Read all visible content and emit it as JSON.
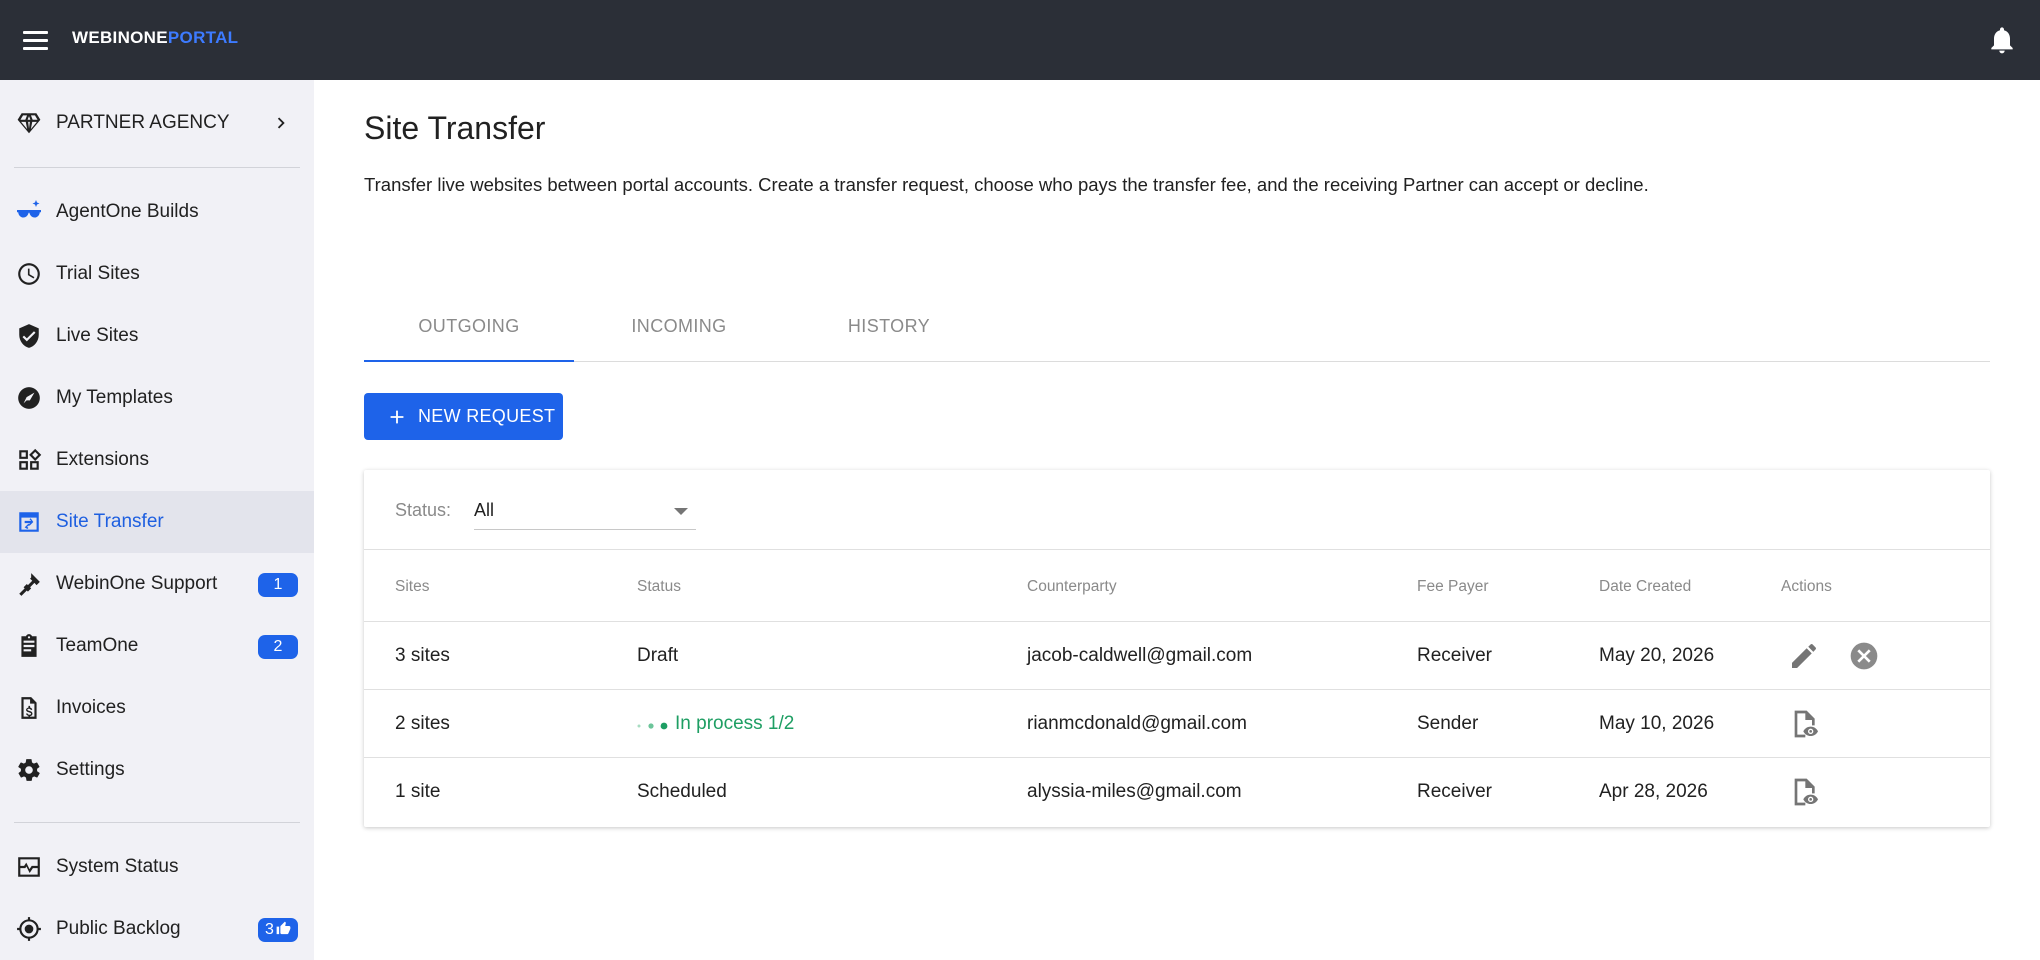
{
  "topbar": {
    "brand_part1": "WEBINONE",
    "brand_part2": "PORTAL",
    "brand_accent_color": "#3d7bff"
  },
  "sidebar": {
    "agency": {
      "label": "PARTNER AGENCY",
      "icon": "diamond-icon"
    },
    "items": [
      {
        "label": "AgentOne Builds",
        "icon": "glasses-sparkle-icon"
      },
      {
        "label": "Trial Sites",
        "icon": "clock-icon"
      },
      {
        "label": "Live Sites",
        "icon": "shield-check-icon"
      },
      {
        "label": "My Templates",
        "icon": "compass-icon"
      },
      {
        "label": "Extensions",
        "icon": "widgets-icon"
      },
      {
        "label": "Site Transfer",
        "icon": "transfer-window-icon",
        "active": true
      },
      {
        "label": "WebinOne Support",
        "icon": "ticket-icon",
        "badge": "1"
      },
      {
        "label": "TeamOne",
        "icon": "clipboard-icon",
        "badge": "2"
      },
      {
        "label": "Invoices",
        "icon": "invoice-icon"
      },
      {
        "label": "Settings",
        "icon": "gear-icon"
      }
    ],
    "footer_items": [
      {
        "label": "System Status",
        "icon": "pulse-icon"
      },
      {
        "label": "Public Backlog",
        "icon": "target-icon",
        "badge": "3"
      }
    ]
  },
  "main": {
    "title": "Site Transfer",
    "description": "Transfer live websites between portal accounts. Create a transfer request, choose who pays the transfer fee, and the receiving Partner can accept or decline.",
    "tabs": [
      "OUTGOING",
      "INCOMING",
      "HISTORY"
    ],
    "active_tab": "OUTGOING",
    "new_button": "NEW REQUEST",
    "filter": {
      "label": "Status:",
      "value": "All"
    },
    "table": {
      "headers": [
        "Sites",
        "Status",
        "Counterparty",
        "Fee Payer",
        "Date Created",
        "Actions"
      ],
      "rows": [
        {
          "sites": "3 sites",
          "status": "Draft",
          "counterparty": "jacob-caldwell@gmail.com",
          "fee_payer": "Receiver",
          "date": "May 20, 2026",
          "actions": [
            "pencil-icon",
            "cancel-circle-icon"
          ]
        },
        {
          "sites": "2 sites",
          "status": "In process 1/2",
          "counterparty": "rianmcdonald@gmail.com",
          "fee_payer": "Sender",
          "date": "May 10, 2026",
          "actions": [
            "document-view-icon"
          ]
        },
        {
          "sites": "1 site",
          "status": "Scheduled",
          "counterparty": "alyssia-miles@gmail.com",
          "fee_payer": "Receiver",
          "date": "Apr 28, 2026",
          "actions": [
            "document-view-icon"
          ]
        }
      ]
    }
  },
  "colors": {
    "primary": "#1e63e9",
    "topbar": "#2b2f37",
    "sidebar_bg": "#f1f1f6",
    "status_in_process": "#1e9e63"
  }
}
